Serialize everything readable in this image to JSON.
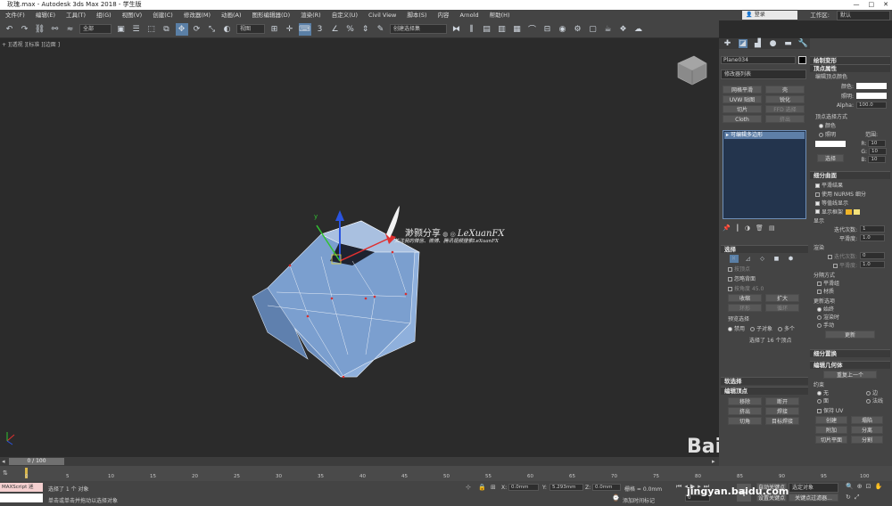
{
  "window": {
    "title": "玫瑰.max - Autodesk 3ds Max 2018 - 学生版",
    "controls": [
      "—",
      "□",
      "✕"
    ]
  },
  "menu": {
    "items": [
      "文件(F)",
      "编辑(E)",
      "工具(T)",
      "组(G)",
      "视图(V)",
      "创建(C)",
      "修改器(M)",
      "动画(A)",
      "图形编辑器(D)",
      "渲染(R)",
      "自定义(U)",
      "Civil View",
      "脚本(S)",
      "内容",
      "Arnold",
      "帮助(H)"
    ],
    "login": "登录",
    "workspace_label": "工作区:",
    "workspace_value": "默认"
  },
  "toolbar": {
    "filter_combo": "全部",
    "view_combo": "视图",
    "selection_set_combo": "创建选择集"
  },
  "viewport": {
    "label": "+ ][透视 ][标准 ][边面 ]"
  },
  "watermark": {
    "brand": "渺颢分享",
    "brand_latin": "LeXuanFX",
    "tagline": "关注我的微信、微博、腾讯视频搜索LeXuanFX",
    "site_logo": "Bai 经验",
    "site_url": "jingyan.baidu.com"
  },
  "modifier": {
    "object_name": "Plane034",
    "list_label": "修改器列表",
    "buttons": [
      {
        "left": "网格平滑",
        "right": "壳"
      },
      {
        "left": "UVW 贴图",
        "right": "锐化"
      },
      {
        "left": "切片",
        "right": "FFD 选择"
      },
      {
        "left": "Cloth",
        "right": "挤出"
      }
    ],
    "stack_item": "可编辑多边形",
    "selection": {
      "header": "选择",
      "by_vertex": "按顶点",
      "ignore_backface": "忽略背面",
      "by_angle": "按角度",
      "angle_value": "45.0",
      "shrink": "收缩",
      "grow": "扩大",
      "ring": "环形",
      "loop": "循环",
      "preview_label": "预览选择",
      "preview_off": "禁用",
      "preview_sub": "子对象",
      "preview_multi": "多个",
      "status": "选择了 16 个顶点"
    },
    "soft_select_header": "软选择",
    "edit_vertices": {
      "header": "编辑顶点",
      "remove": "移除",
      "break": "断开",
      "extrude": "挤出",
      "weld": "焊接",
      "chamfer": "切角",
      "target_weld": "目标焊接"
    }
  },
  "right_panel": {
    "paint_deform": "绘制变形",
    "vertex_props": "顶点属性",
    "edit_vertex_color": "编辑顶点颜色",
    "color_label": "颜色:",
    "illum_label": "照明:",
    "alpha_label": "Alpha:",
    "alpha_value": "100.0",
    "select_by": "顶点选择方式",
    "select_color": "颜色",
    "select_illum": "照明",
    "range_label": "范围:",
    "r_label": "R:",
    "g_label": "G:",
    "b_label": "B:",
    "range_value": "10",
    "select_btn": "选择",
    "subdivision": "细分曲面",
    "smooth_result": "平滑结果",
    "use_nurms": "使用 NURMS 细分",
    "isoline": "等值线显示",
    "show_cage": "显示框架",
    "display_label": "显示",
    "iterations": "迭代次数:",
    "iterations_value": "1",
    "smoothness": "平滑度:",
    "smoothness_value": "1.0",
    "render_label": "渲染",
    "render_iter_value": "0",
    "render_smooth_value": "1.0",
    "separate_by": "分隔方式",
    "smoothing_groups": "平滑组",
    "materials": "材质",
    "update_options": "更新选项",
    "always": "始终",
    "when_rendering": "渲染时",
    "manually": "手动",
    "update_btn": "更新",
    "subdiv_displace": "细分置换",
    "edit_geometry": "编辑几何体",
    "repeat_last": "重复上一个",
    "constraints": "约束",
    "none": "无",
    "edge": "边",
    "face": "面",
    "normal": "法线",
    "preserve_uv": "保持 UV",
    "create": "创建",
    "collapse": "塌陷",
    "attach": "附加",
    "detach": "分离",
    "slice_plane": "切片平面",
    "split": "分割"
  },
  "timeline": {
    "frame": "0 / 100",
    "ticks": [
      "0",
      "5",
      "10",
      "15",
      "20",
      "25",
      "30",
      "35",
      "40",
      "45",
      "50",
      "55",
      "60",
      "65",
      "70",
      "75",
      "80",
      "85",
      "90",
      "95",
      "100"
    ]
  },
  "status": {
    "maxscript": "MAXScript 迷",
    "selected": "选择了 1 个 对象",
    "hint": "单击或单击并拖动以选择对象",
    "x_label": "X:",
    "x_value": "0.0mm",
    "y_label": "Y:",
    "y_value": "5.293mm",
    "z_label": "Z:",
    "z_value": "0.0mm",
    "grid": "栅格 = 0.0mm",
    "add_time_tag": "添加时间标记",
    "auto_key": "自动关键点",
    "selected_obj": "选定对象",
    "set_key": "设置关键点",
    "key_filters": "关键点过滤器...",
    "frame_value": "0"
  }
}
